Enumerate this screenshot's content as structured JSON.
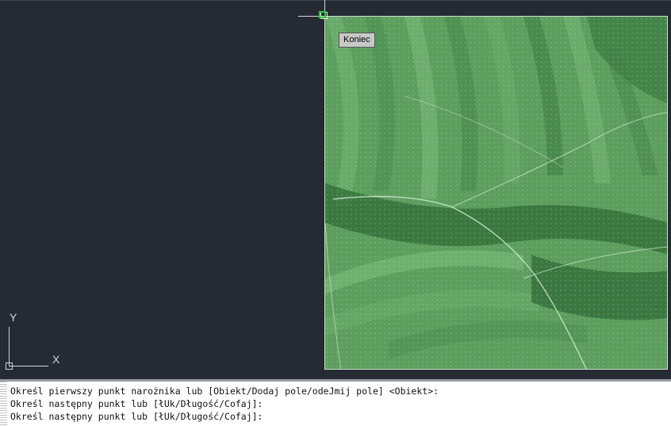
{
  "tooltip": {
    "label": "Koniec"
  },
  "ucs": {
    "x_label": "X",
    "y_label": "Y"
  },
  "command_history": [
    "Określ pierwszy punkt narożnika lub [Obiekt/Dodaj pole/odeJmij pole] <Obiekt>:",
    "Określ następny punkt lub [łUk/Długość/Cofaj]:",
    "Określ następny punkt lub [łUk/Długość/Cofaj]:"
  ],
  "colors": {
    "viewport_background": "#262b33",
    "raster_tint": "#5d9e5f",
    "snap_marker": "#2ecc40",
    "tooltip_background": "#c8c8c8"
  },
  "icons": [
    "crosshair-cursor",
    "endpoint-snap-marker",
    "ucs-icon"
  ]
}
